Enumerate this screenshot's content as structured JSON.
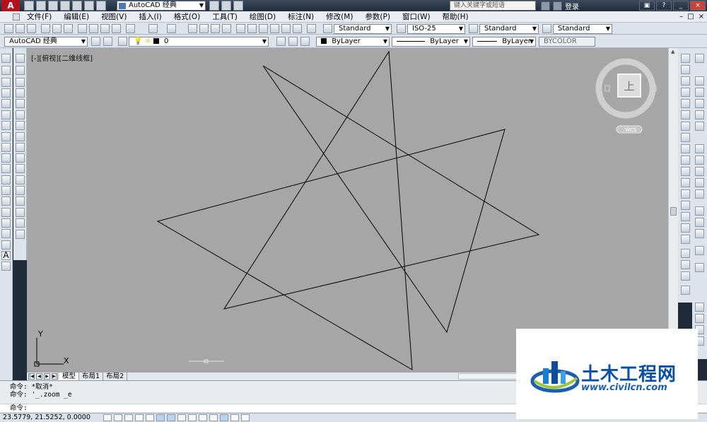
{
  "title_bar": {
    "app_logo": "A",
    "workspace": "AutoCAD 经典",
    "search_placeholder": "键入关键字或短语",
    "login": "登录"
  },
  "menu": {
    "items": [
      "文件(F)",
      "编辑(E)",
      "视图(V)",
      "插入(I)",
      "格式(O)",
      "工具(T)",
      "绘图(D)",
      "标注(N)",
      "修改(M)",
      "参数(P)",
      "窗口(W)",
      "帮助(H)"
    ]
  },
  "toolbar1": {
    "text_style": "Standard",
    "dim_style": "ISO-25",
    "table_style": "Standard",
    "multileader_style": "Standard"
  },
  "toolbar2": {
    "workspace": "AutoCAD 经典",
    "layer": "0",
    "color": "ByLayer",
    "linetype": "ByLayer",
    "lineweight": "ByLayer",
    "plot_style": "BYCOLOR"
  },
  "viewport": {
    "label": "[-][俯视][二维线框]",
    "viewcube_face": "上",
    "wcs": "WCS",
    "ucs_x": "X",
    "ucs_y": "Y"
  },
  "tabs": [
    "模型",
    "布局1",
    "布局2"
  ],
  "command": {
    "line1": "命令: *取消*",
    "line2": "命令: '_.zoom _e",
    "prompt": "命令:"
  },
  "status": {
    "coordinates": "23.5779,  21.5252, 0.0000"
  },
  "watermark": {
    "title": "土木工程网",
    "url": "www.civilcn.com"
  },
  "drawing_colors": {
    "background": "#a6a6a6",
    "lines": "#000000"
  }
}
